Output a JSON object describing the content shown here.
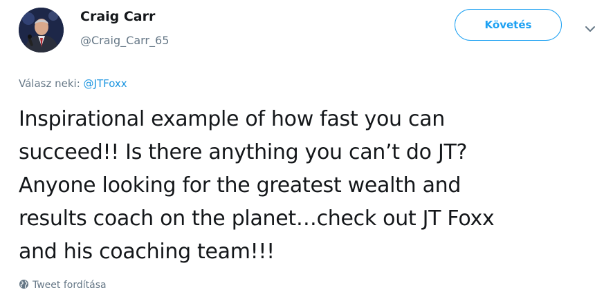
{
  "author": {
    "display_name": "Craig Carr",
    "screen_name": "@Craig_Carr_65"
  },
  "actions": {
    "follow_label": "Követés",
    "menu_icon": "chevron-down-icon"
  },
  "reply_context": {
    "prefix": "Válasz neki:",
    "mention": "@JTFoxx"
  },
  "tweet": {
    "text": "Inspirational example of how fast you can\nsucceed!! Is there anything you can’t do JT?\nAnyone looking for the greatest wealth and\nresults coach on the planet…check out JT Foxx\nand his coaching team!!!"
  },
  "translate": {
    "label": "Tweet fordítása",
    "icon": "globe-icon"
  },
  "colors": {
    "accent": "#1da1f2",
    "link": "#1b95e0",
    "secondary_text": "#657786",
    "primary_text": "#14171a"
  }
}
